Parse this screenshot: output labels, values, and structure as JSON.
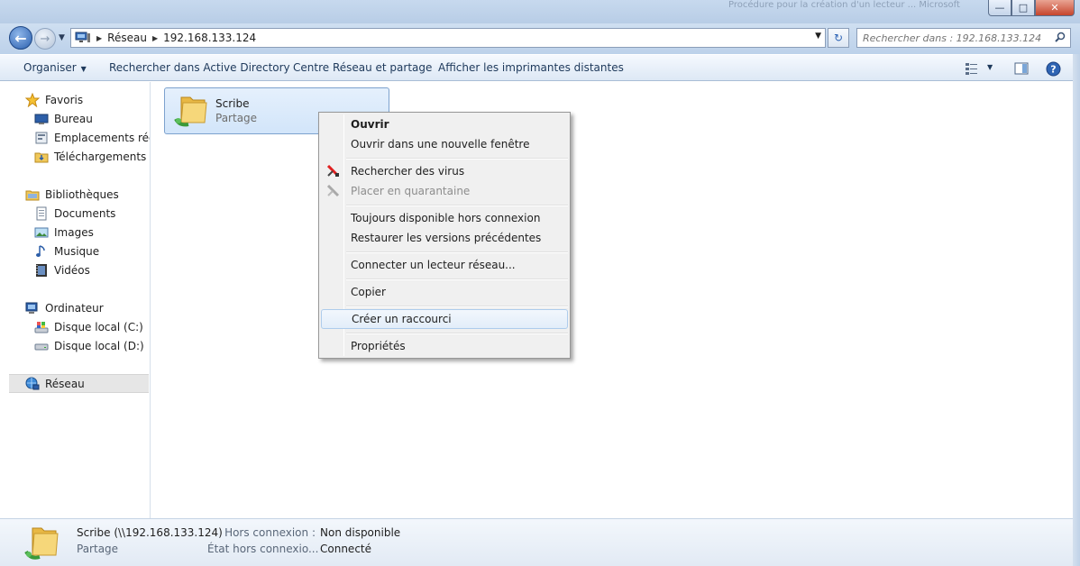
{
  "window": {
    "title_blurred": "Procédure pour la création d'un lecteur ... Microsoft",
    "controls": {
      "minimize": "—",
      "maximize": "□",
      "close": "✕"
    }
  },
  "navigation": {
    "back_glyph": "←",
    "forward_glyph": "→",
    "breadcrumb": [
      "Réseau",
      "192.168.133.124"
    ],
    "search_placeholder": "Rechercher dans : 192.168.133.124",
    "refresh_glyph": "↻"
  },
  "toolbar": {
    "organize": "Organiser",
    "search_ad": "Rechercher dans Active Directory",
    "network_center": "Centre Réseau et partage",
    "remote_printers": "Afficher les imprimantes distantes"
  },
  "sidebar": {
    "groups": [
      {
        "label": "Favoris",
        "icon": "star-icon",
        "items": [
          {
            "label": "Bureau",
            "icon": "desktop-icon"
          },
          {
            "label": "Emplacements récents",
            "icon": "recent-places-icon"
          },
          {
            "label": "Téléchargements",
            "icon": "downloads-icon"
          }
        ]
      },
      {
        "label": "Bibliothèques",
        "icon": "libraries-icon",
        "items": [
          {
            "label": "Documents",
            "icon": "documents-icon"
          },
          {
            "label": "Images",
            "icon": "images-icon"
          },
          {
            "label": "Musique",
            "icon": "music-icon"
          },
          {
            "label": "Vidéos",
            "icon": "videos-icon"
          }
        ]
      },
      {
        "label": "Ordinateur",
        "icon": "computer-icon",
        "items": [
          {
            "label": "Disque local (C:)",
            "icon": "disk-c-icon"
          },
          {
            "label": "Disque local (D:)",
            "icon": "disk-d-icon"
          }
        ]
      },
      {
        "label": "Réseau",
        "icon": "network-icon",
        "items": [],
        "selected": true
      }
    ]
  },
  "content": {
    "items": [
      {
        "name": "Scribe",
        "type": "Partage"
      }
    ]
  },
  "context_menu": {
    "items": [
      {
        "label": "Ouvrir",
        "bold": true
      },
      {
        "label": "Ouvrir dans une nouvelle fenêtre"
      },
      {
        "label": "Rechercher des virus",
        "icon": "antivirus-icon"
      },
      {
        "label": "Placer en quarantaine",
        "icon": "quarantine-icon",
        "disabled": true
      },
      {
        "label": "Toujours disponible hors connexion"
      },
      {
        "label": "Restaurer les versions précédentes"
      },
      {
        "label": "Connecter un lecteur réseau..."
      },
      {
        "label": "Copier"
      },
      {
        "label": "Créer un raccourci",
        "hover": true
      },
      {
        "label": "Propriétés"
      }
    ]
  },
  "details": {
    "name": "Scribe",
    "path": "(\\\\192.168.133.124)",
    "type": "Partage",
    "offline_label": "Hors connexion :",
    "offline_value": "Non disponible",
    "offline_state_label": "État hors connexio...",
    "offline_state_value": "Connecté"
  },
  "colors": {
    "accent": "#2a5fae",
    "toolbar_text": "#1e395b",
    "selection": "#d2e5fa",
    "menu_bg": "#f0f0f0"
  }
}
